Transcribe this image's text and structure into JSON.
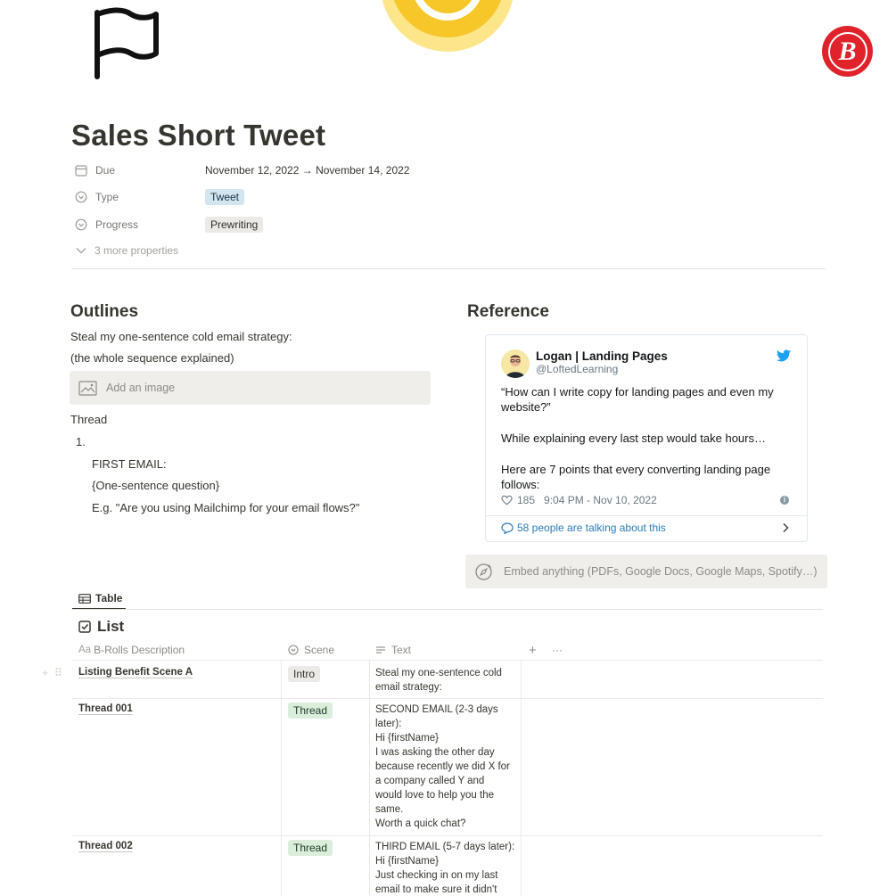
{
  "page": {
    "title": "Sales Short Tweet",
    "icon": "flag-icon",
    "cover_icon": "coin-icon",
    "brand_logo_letter": "B"
  },
  "properties": [
    {
      "name": "Due",
      "icon": "calendar-icon",
      "value": "November 12, 2022 → November 14, 2022"
    },
    {
      "name": "Type",
      "icon": "select-icon",
      "value": "Tweet",
      "color": "#d3e5ef"
    },
    {
      "name": "Progress",
      "icon": "select-icon",
      "value": "Prewriting",
      "color": "#ebeae7"
    }
  ],
  "more_properties": "3 more properties",
  "outlines": {
    "heading": "Outlines",
    "line1": "Steal my one-sentence cold email strategy:",
    "line2": "(the whole sequence explained)",
    "add_image": "Add an image",
    "thread_label": "Thread",
    "list_number": "1.",
    "sub1": "FIRST EMAIL:",
    "sub2": "{One-sentence question}",
    "sub3": "E.g. \"Are you using Mailchimp for your email flows?\""
  },
  "reference": {
    "heading": "Reference",
    "tweet": {
      "author": "Logan | Landing Pages",
      "handle": "@LoftedLearning",
      "para1": "“How can I write copy for landing pages and even my website?”",
      "para2": "While explaining every last step would take hours…",
      "para3": "Here are 7 points that every converting landing page follows:",
      "likes": "185",
      "timestamp": "9:04 PM - Nov 10, 2022",
      "talking": "58 people are talking about this"
    },
    "embed": "Embed anything (PDFs, Google Docs, Google Maps, Spotify…)"
  },
  "database": {
    "view_tab": "Table",
    "title": "List",
    "columns": {
      "name_prefix": "Aa",
      "name": "B-Rolls Description",
      "scene": "Scene",
      "text": "Text"
    },
    "add_column": "+",
    "more_options": "···",
    "rows": [
      {
        "name": "Listing Benefit Scene A",
        "scene": "Intro",
        "text": "Steal my one-sentence cold\nemail strategy:"
      },
      {
        "name": "Thread 001",
        "scene": "Thread",
        "text": "SECOND EMAIL (2-3 days\nlater):\nHi {firstName}\nI was asking the other day\nbecause recently we did X for\na company called Y and\nwould love to help you the\nsame.\nWorth a quick chat?"
      },
      {
        "name": "Thread 002",
        "scene": "Thread",
        "text": "THIRD EMAIL (5-7 days later):\nHi {firstName}\nJust checking in on my last\nemail to make sure it didn't"
      }
    ]
  }
}
